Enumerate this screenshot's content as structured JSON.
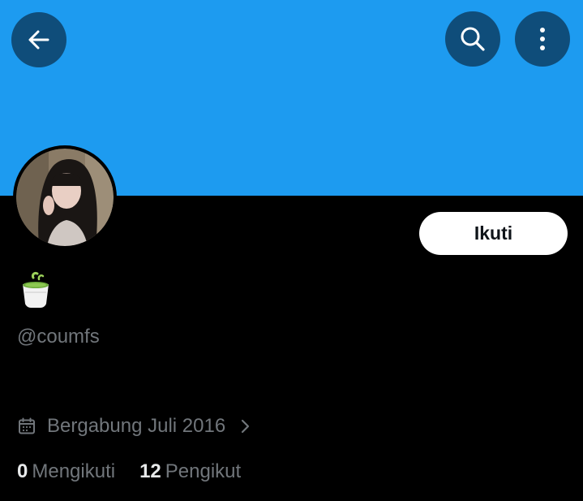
{
  "header": {
    "back_icon": "arrow-left-icon",
    "search_icon": "search-icon",
    "more_icon": "more-vertical-icon",
    "banner_color": "#1d9bf0",
    "button_color": "#0f4d7a"
  },
  "profile": {
    "avatar": "profile-photo",
    "display_name_icon": "green-tea-cup-emoji",
    "handle": "@coumfs",
    "follow_label": "Ikuti",
    "joined_icon": "calendar-icon",
    "joined": "Bergabung Juli 2016",
    "joined_chevron": "chevron-right-icon"
  },
  "stats": {
    "following_count": "0",
    "following_label": "Mengikuti",
    "followers_count": "12",
    "followers_label": "Pengikut"
  }
}
